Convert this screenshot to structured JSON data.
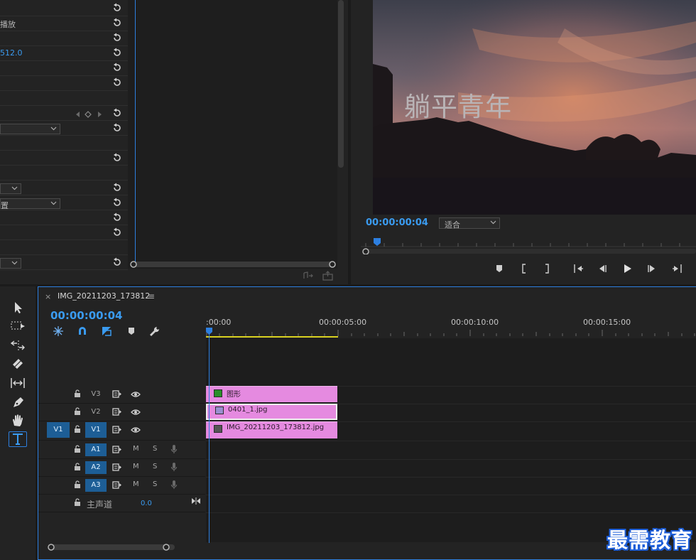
{
  "effect_controls": {
    "rows": [
      {
        "text": ""
      },
      {
        "text": "播放"
      },
      {
        "text": ""
      },
      {
        "text": "512.0",
        "blue": true
      },
      {
        "text": ""
      },
      {
        "text": ""
      },
      {
        "text": ""
      },
      {
        "text": ""
      },
      {
        "text": ""
      },
      {
        "text": ""
      },
      {
        "text": ""
      },
      {
        "text": ""
      },
      {
        "text": ""
      },
      {
        "text": "置"
      },
      {
        "text": ""
      },
      {
        "text": ""
      },
      {
        "text": ""
      },
      {
        "text": ""
      }
    ]
  },
  "program_monitor": {
    "video_title": "躺平青年",
    "timecode": "00:00:00:04",
    "fit_label": "适合"
  },
  "timeline": {
    "tab_close": "×",
    "tab_title": "IMG_20211203_173812",
    "tab_menu": "≡",
    "timecode": "00:00:00:04",
    "ruler_labels": [
      ":00:00",
      "00:00:05:00",
      "00:00:10:00",
      "00:00:15:00"
    ],
    "tracks": {
      "v3": "V3",
      "v2": "V2",
      "v1": "V1",
      "v1_source": "V1",
      "a1": "A1",
      "a2": "A2",
      "a3": "A3",
      "mute": "M",
      "solo": "S"
    },
    "clips": {
      "v3": "图形",
      "v2": "0401_1.jpg",
      "v1": "IMG_20211203_173812.jpg"
    },
    "master": {
      "label": "主声道",
      "value": "0.0"
    }
  },
  "watermark": "最需教育",
  "colors": {
    "accent_blue": "#2d7fe0",
    "clip_pink": "#e58ae0",
    "work_area": "#d8d020"
  }
}
